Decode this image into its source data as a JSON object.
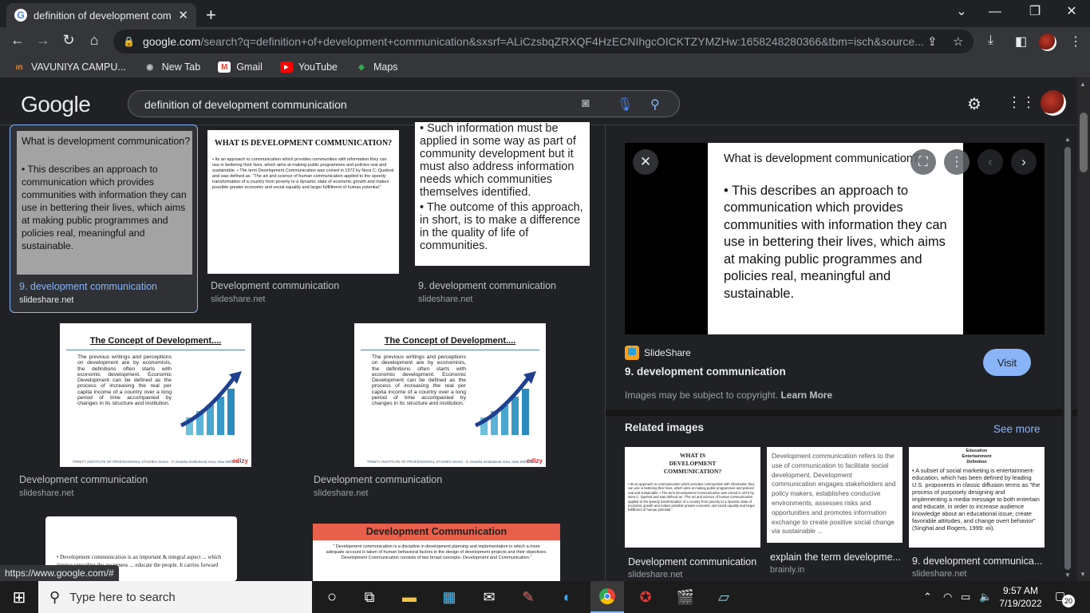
{
  "browser": {
    "tab_title": "definition of development comm",
    "tab_favicon": "G",
    "tab_close": "✕",
    "new_tab": "+",
    "url_host": "google.com",
    "url_rest": "/search?q=definition+of+development+communication&sxsrf=ALiCzsbqZRXQF4HzECNIhgcOICKTZYMZHw:1658248280366&tbm=isch&source...",
    "bookmarks": [
      {
        "label": "VAVUNIYA CAMPU...",
        "icon": "vavuniya-icon",
        "color": "#f28b20",
        "glyph": "ın"
      },
      {
        "label": "New Tab",
        "icon": "globe-icon",
        "color": "#5f6368",
        "glyph": "◉"
      },
      {
        "label": "Gmail",
        "icon": "gmail-icon",
        "color": "#ea4335",
        "glyph": "M"
      },
      {
        "label": "YouTube",
        "icon": "youtube-icon",
        "color": "#ff0000",
        "glyph": "▶"
      },
      {
        "label": "Maps",
        "icon": "maps-icon",
        "color": "#34a853",
        "glyph": "◆"
      }
    ]
  },
  "google": {
    "logo": "Google",
    "query": "definition of development communication"
  },
  "results": [
    {
      "title": "9. development communication",
      "source": "slideshare.net",
      "selected": true,
      "slide_heading": "What is development communication?",
      "slide_text": "• This describes an approach to communication which provides communities with information they can use in bettering their lives, which aims at making public programmes and policies real, meaningful and sustainable."
    },
    {
      "title": "Development communication",
      "source": "slideshare.net",
      "slide_heading": "WHAT IS DEVELOPMENT COMMUNICATION?",
      "slide_text": "• Its an approach to communication which provides communities with information they can use in bettering their lives, which aims at making public programmes and policies real and sustainable. • The term Development Communication was coined in 1972 by Nora C. Quebral and was defined as: \"The art and science of human communication applied to the speedy transformation of a country from poverty to a dynamic state of economic growth and makes possible greater economic and social equality and larger fulfillment of human potential.\""
    },
    {
      "title": "9. development communication",
      "source": "slideshare.net",
      "slide_text_a": "• Such information must be applied in some way as part of community development but it must also address information needs which communities themselves identified.",
      "slide_text_b": "• The outcome of this approach, in short, is to make a difference in the quality of life of communities."
    },
    {
      "title": "Development communication",
      "source": "slideshare.net",
      "slide_heading": "The Concept of Development....",
      "slide_text": "The previous writings and perceptions on development are by economists, the definitions often starts with economic development. Economic Development can be defined as the process of increasing the real per capita income of a country over a long period of time accompanied by changes in its structure and institution.",
      "footer": "TRINITY INSTITUTE OF PROFESSIONAL STUDIES Sector - 9, Dwarka Institutional Area, New Delhi-75",
      "brand": "edizy"
    },
    {
      "title": "Development communication",
      "source": "slideshare.net",
      "slide_heading": "The Concept of Development....",
      "slide_text": "The previous writings and perceptions on development are by economists, the definitions often starts with economic development. Economic Development can be defined as the process of increasing the real per capita income of a country over a long period of time accompanied by changes in its structure and institution.",
      "footer": "TRINITY INSTITUTE OF PROFESSIONAL STUDIES Sector - 9, Dwarka Institutional Area, New Delhi-75",
      "brand": "edizy"
    },
    {
      "slide_text": "• Development communication is an important & integral aspect ... which intense spreading the awareness ... educate the people. It carries forward the"
    },
    {
      "slide_heading": "Development Communication",
      "slide_text": "\" Development communication is a discipline in development planning and implementation in which a more adequate account is taken of human behavioral factors in the design of development projects and their objectives. Development Communication consists of two broad concepts- Development and Communication.\""
    }
  ],
  "panel": {
    "heading": "What is development communication?",
    "text": "• This describes an approach to communication which provides communities with information they can use in bettering their lives, which aims at making public programmes and policies real, meaningful and sustainable.",
    "site": "SlideShare",
    "title": "9. development communication",
    "visit": "Visit",
    "copyright": "Images may be subject to copyright.",
    "learn_more": "Learn More",
    "related_heading": "Related images",
    "see_more": "See more",
    "related": [
      {
        "title": "Development communication",
        "source": "slideshare.net",
        "heading": "WHAT IS DEVELOPMENT COMMUNICATION?",
        "text": "• Its an approach to communication which provides communities with information they can use in bettering their lives, which aims at making public programmes and policies real and sustainable. • The term Development Communication was coined in 1972 by Nora C. Quebral and was defined as: \"The art and science of human communication applied to the speedy transformation of a country from poverty to a dynamic state of economic growth and makes possible greater economic and social equality and larger fulfillment of human potential.\""
      },
      {
        "title": "explain the term developme...",
        "source": "brainly.in",
        "text": "Development communication refers to the use of communication to facilitate social development. Development communication engages stakeholders and policy makers, establishes conducive environments, assesses risks and opportunities and promotes information exchange to create positive social change via sustainable ..."
      },
      {
        "title": "9. development communica...",
        "source": "slideshare.net",
        "heading": "Education Entertainment Definition",
        "text": "• A subset of social marketing is entertainment-education, which has been defined by leading U.S. proponents in classic diffusion terms as \"the process of purposely designing and implementing a media message to both entertain and educate, in order to increase audience knowledge about an educational issue, create favorable attitudes, and change overt behavior\" (Singhal and Rogers, 1999: xii)."
      }
    ]
  },
  "status_url": "https://www.google.com/#",
  "taskbar": {
    "search_placeholder": "Type here to search",
    "time": "9:57 AM",
    "date": "7/19/2022",
    "notif_count": "20"
  }
}
